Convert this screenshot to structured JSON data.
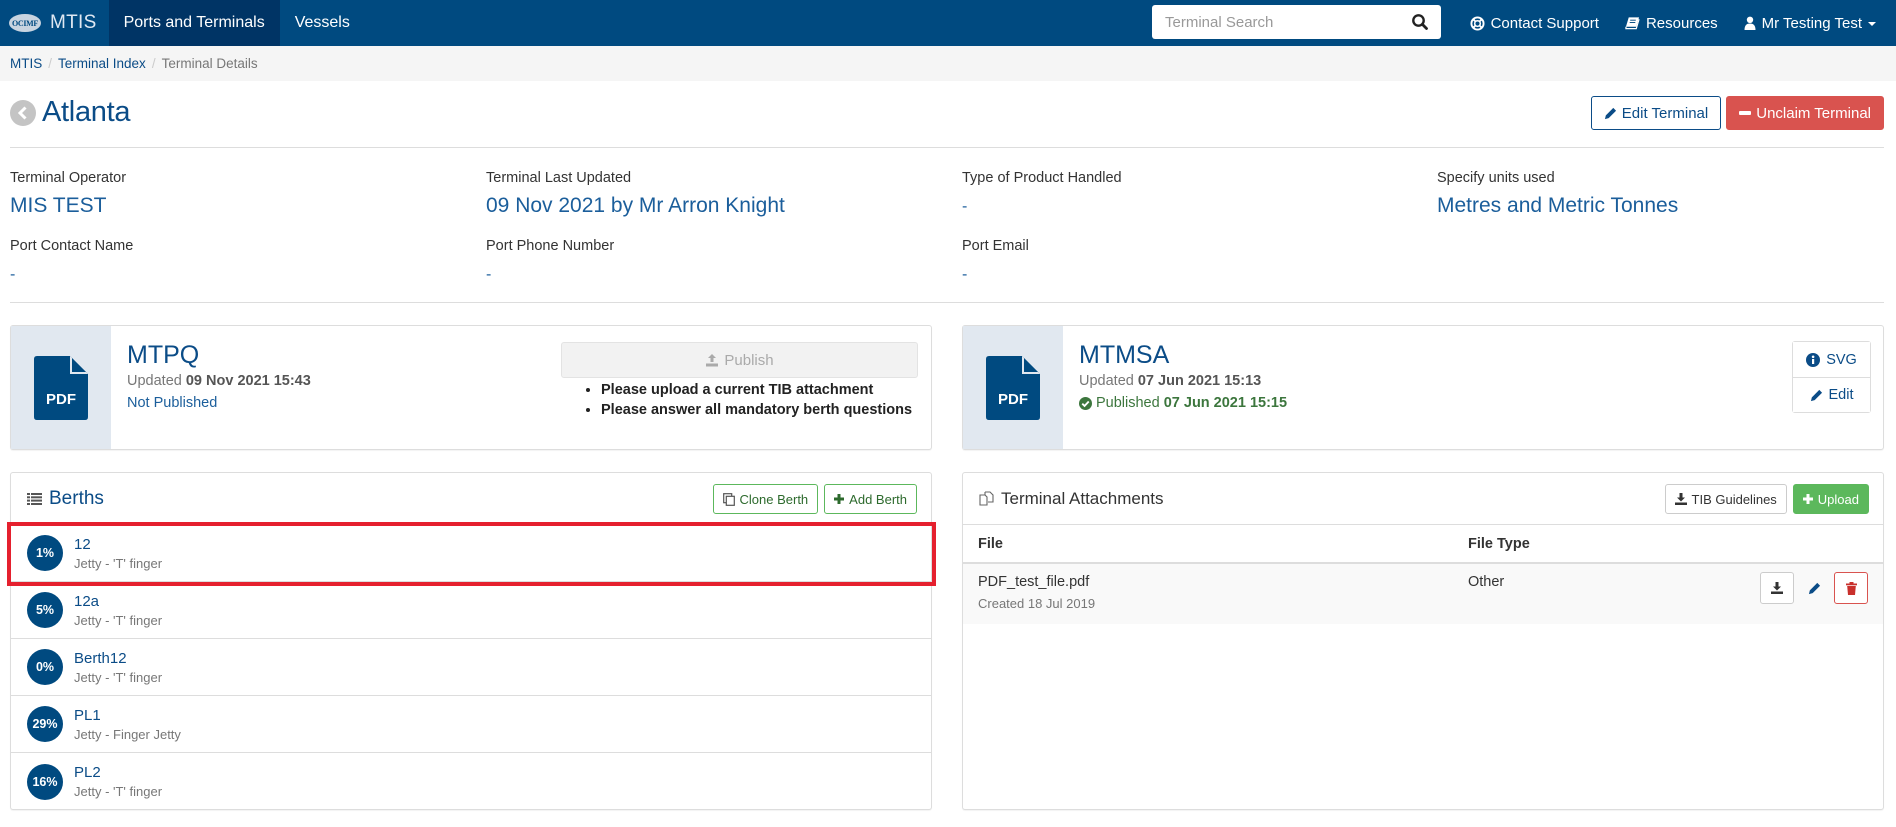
{
  "navbar": {
    "logo_text": "OCIMF",
    "brand": "MTIS",
    "items": [
      {
        "label": "Ports and Terminals",
        "active": true
      },
      {
        "label": "Vessels",
        "active": false
      }
    ],
    "search_placeholder": "Terminal Search",
    "search_value": "",
    "contact_support": "Contact Support",
    "resources": "Resources",
    "user": "Mr Testing Test"
  },
  "breadcrumb": [
    "MTIS",
    "Terminal Index",
    "Terminal Details"
  ],
  "page": {
    "title": "Atlanta",
    "edit_button": "Edit Terminal",
    "unclaim_button": "Unclaim Terminal"
  },
  "info": [
    {
      "label": "Terminal Operator",
      "value": "MIS TEST"
    },
    {
      "label": "Terminal Last Updated",
      "value": "09 Nov 2021 by Mr Arron Knight"
    },
    {
      "label": "Type of Product Handled",
      "value": "-"
    },
    {
      "label": "Specify units used",
      "value": "Metres and Metric Tonnes"
    },
    {
      "label": "Port Contact Name",
      "value": "-"
    },
    {
      "label": "Port Phone Number",
      "value": "-"
    },
    {
      "label": "Port Email",
      "value": "-"
    }
  ],
  "mtpq": {
    "icon_label": "PDF",
    "title": "MTPQ",
    "updated_prefix": "Updated",
    "updated": "09 Nov 2021 15:43",
    "status": "Not Published",
    "publish_button": "Publish",
    "requirements": [
      "Please upload a current TIB attachment",
      "Please answer all mandatory berth questions"
    ]
  },
  "mtmsa": {
    "icon_label": "PDF",
    "title": "MTMSA",
    "updated_prefix": "Updated",
    "updated": "07 Jun 2021 15:13",
    "published_prefix": "Published",
    "published": "07 Jun 2021 15:15",
    "svg_button": "SVG",
    "edit_button": "Edit"
  },
  "berths": {
    "title": "Berths",
    "clone_button": "Clone Berth",
    "add_button": "Add Berth",
    "items": [
      {
        "name": "12",
        "type": "Jetty - 'T' finger",
        "completion": "1%"
      },
      {
        "name": "12a",
        "type": "Jetty - 'T' finger",
        "completion": "5%"
      },
      {
        "name": "Berth12",
        "type": "Jetty - 'T' finger",
        "completion": "0%"
      },
      {
        "name": "PL1",
        "type": "Jetty - Finger Jetty",
        "completion": "29%"
      },
      {
        "name": "PL2",
        "type": "Jetty - 'T' finger",
        "completion": "16%"
      }
    ]
  },
  "attachments": {
    "title": "Terminal Attachments",
    "guidelines_button": "TIB Guidelines",
    "upload_button": "Upload",
    "columns": [
      "File",
      "File Type"
    ],
    "rows": [
      {
        "file": "PDF_test_file.pdf",
        "created": "Created 18 Jul 2019",
        "type": "Other"
      }
    ]
  },
  "colors": {
    "brand": "#004a80",
    "link": "#0b4c87",
    "danger": "#d9534f",
    "success": "#5cb85c",
    "highlight": "#e5202e"
  }
}
